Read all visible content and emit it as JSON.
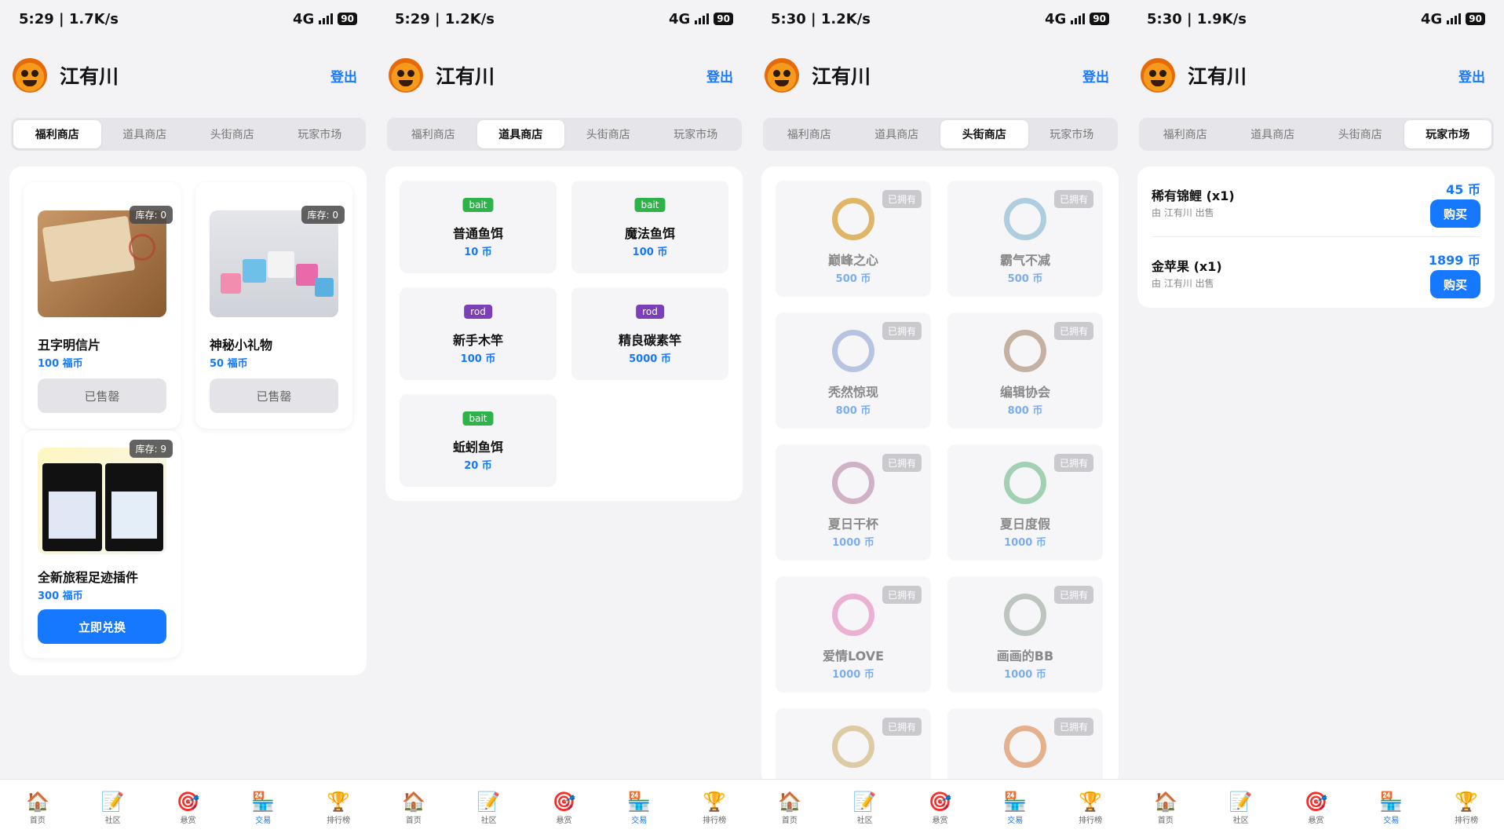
{
  "screens": [
    {
      "status": {
        "time": "5:29 | 1.7K/s",
        "network": "4G",
        "battery": "90"
      },
      "header": {
        "username": "江有川",
        "logout": "登出"
      },
      "tabs": [
        "福利商店",
        "道具商店",
        "头街商店",
        "玩家市场"
      ],
      "active_tab": 0,
      "welfare": [
        {
          "name": "丑字明信片",
          "price": "100 福币",
          "stock": "库存: 0",
          "button": "已售罄",
          "available": false
        },
        {
          "name": "神秘小礼物",
          "price": "50 福币",
          "stock": "库存: 0",
          "button": "已售罄",
          "available": false
        },
        {
          "name": "全新旅程足迹插件",
          "price": "300 福币",
          "stock": "库存: 9",
          "button": "立即兑换",
          "available": true
        }
      ]
    },
    {
      "status": {
        "time": "5:29 | 1.2K/s",
        "network": "4G",
        "battery": "90"
      },
      "header": {
        "username": "江有川",
        "logout": "登出"
      },
      "tabs": [
        "福利商店",
        "道具商店",
        "头街商店",
        "玩家市场"
      ],
      "active_tab": 1,
      "props": [
        {
          "tag": "bait",
          "name": "普通鱼饵",
          "price": "10 币"
        },
        {
          "tag": "bait",
          "name": "魔法鱼饵",
          "price": "100 币"
        },
        {
          "tag": "rod",
          "name": "新手木竿",
          "price": "100 币"
        },
        {
          "tag": "rod",
          "name": "精良碳素竿",
          "price": "5000 币"
        },
        {
          "tag": "bait",
          "name": "蚯蚓鱼饵",
          "price": "20 币"
        }
      ]
    },
    {
      "status": {
        "time": "5:30 | 1.2K/s",
        "network": "4G",
        "battery": "90"
      },
      "header": {
        "username": "江有川",
        "logout": "登出"
      },
      "tabs": [
        "福利商店",
        "道具商店",
        "头街商店",
        "玩家市场"
      ],
      "active_tab": 2,
      "frames": [
        {
          "name": "巅峰之心",
          "price": "500 币",
          "owned": "已拥有",
          "color": "#d9a640"
        },
        {
          "name": "霸气不减",
          "price": "500 币",
          "owned": "已拥有",
          "color": "#9cc3d8"
        },
        {
          "name": "秃然惊现",
          "price": "800 币",
          "owned": "已拥有",
          "color": "#a8b8d8"
        },
        {
          "name": "编辑协会",
          "price": "800 币",
          "owned": "已拥有",
          "color": "#b8a08c"
        },
        {
          "name": "夏日干杯",
          "price": "1000 币",
          "owned": "已拥有",
          "color": "#c8a0b8"
        },
        {
          "name": "夏日度假",
          "price": "1000 币",
          "owned": "已拥有",
          "color": "#8cc8a0"
        },
        {
          "name": "爱情LOVE",
          "price": "1000 币",
          "owned": "已拥有",
          "color": "#e8a0c8"
        },
        {
          "name": "画画的BB",
          "price": "1000 币",
          "owned": "已拥有",
          "color": "#b0b8b0"
        },
        {
          "name": "",
          "price": "",
          "owned": "已拥有",
          "color": "#d8c090"
        },
        {
          "name": "",
          "price": "",
          "owned": "已拥有",
          "color": "#e0a070"
        }
      ]
    },
    {
      "status": {
        "time": "5:30 | 1.9K/s",
        "network": "4G",
        "battery": "90"
      },
      "header": {
        "username": "江有川",
        "logout": "登出"
      },
      "tabs": [
        "福利商店",
        "道具商店",
        "头街商店",
        "玩家市场"
      ],
      "active_tab": 3,
      "market": [
        {
          "title": "稀有锦鲤 (x1)",
          "seller": "由 江有川 出售",
          "price": "45 币",
          "button": "购买"
        },
        {
          "title": "金苹果 (x1)",
          "seller": "由 江有川 出售",
          "price": "1899 币",
          "button": "购买"
        }
      ]
    }
  ],
  "bottom_nav": [
    {
      "label": "首页",
      "icon": "home-icon",
      "glyph": "🏠"
    },
    {
      "label": "社区",
      "icon": "community-icon",
      "glyph": "📝"
    },
    {
      "label": "悬赏",
      "icon": "target-icon",
      "glyph": "🎯"
    },
    {
      "label": "交易",
      "icon": "trade-icon",
      "glyph": "🏪"
    },
    {
      "label": "排行榜",
      "icon": "trophy-icon",
      "glyph": "🏆"
    }
  ],
  "bottom_nav_active": 3,
  "colors": {
    "accent": "#1677ff",
    "bait": "#2db34a",
    "rod": "#7b3fb8"
  }
}
